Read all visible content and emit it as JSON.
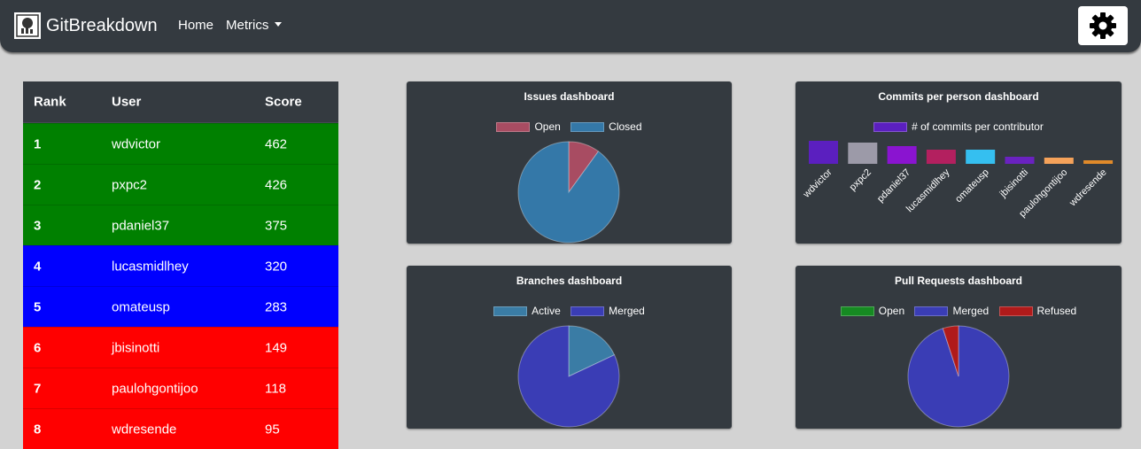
{
  "navbar": {
    "brand": "GitBreakdown",
    "home_label": "Home",
    "metrics_label": "Metrics",
    "logo_icon": "github-logo-icon",
    "settings_icon": "gear-icon"
  },
  "ranking": {
    "headers": [
      "Rank",
      "User",
      "Score"
    ],
    "rows": [
      {
        "rank": "1",
        "user": "wdvictor",
        "score": "462",
        "color": "#008000"
      },
      {
        "rank": "2",
        "user": "pxpc2",
        "score": "426",
        "color": "#008000"
      },
      {
        "rank": "3",
        "user": "pdaniel37",
        "score": "375",
        "color": "#008000"
      },
      {
        "rank": "4",
        "user": "lucasmidlhey",
        "score": "320",
        "color": "#0000ff"
      },
      {
        "rank": "5",
        "user": "omateusp",
        "score": "283",
        "color": "#0000ff"
      },
      {
        "rank": "6",
        "user": "jbisinotti",
        "score": "149",
        "color": "#ff0000"
      },
      {
        "rank": "7",
        "user": "paulohgontijoo",
        "score": "118",
        "color": "#ff0000"
      },
      {
        "rank": "8",
        "user": "wdresende",
        "score": "95",
        "color": "#ff0000"
      }
    ]
  },
  "issues": {
    "title": "Issues dashboard",
    "legend": [
      "Open",
      "Closed"
    ]
  },
  "commits": {
    "title": "Commits per person dashboard",
    "legend": "# of commits per contributor"
  },
  "branches": {
    "title": "Branches dashboard",
    "legend": [
      "Active",
      "Merged"
    ]
  },
  "pulls": {
    "title": "Pull Requests dashboard",
    "legend": [
      "Open",
      "Merged",
      "Refused"
    ]
  },
  "chart_data": [
    {
      "type": "pie",
      "title": "Issues dashboard",
      "labels": [
        "Open",
        "Closed"
      ],
      "values": [
        10,
        90
      ],
      "colors": [
        "#a84c62",
        "#3478a8"
      ]
    },
    {
      "type": "bar",
      "title": "Commits per person dashboard",
      "series": [
        {
          "name": "# of commits per contributor",
          "values": [
            26,
            24,
            20,
            16,
            16,
            8,
            7,
            4
          ]
        }
      ],
      "categories": [
        "wdvictor",
        "pxpc2",
        "pdaniel37",
        "lucasmidlhey",
        "omateusp",
        "jbisinotti",
        "paulohgontijoo",
        "wdresende"
      ],
      "colors": [
        "#5b1fbf",
        "#9c9aa8",
        "#8a14d0",
        "#b3205f",
        "#35bff0",
        "#6a22c0",
        "#f5a25a",
        "#e08a2a"
      ]
    },
    {
      "type": "pie",
      "title": "Branches dashboard",
      "labels": [
        "Active",
        "Merged"
      ],
      "values": [
        18,
        82
      ],
      "colors": [
        "#3a7ca5",
        "#3a3db5"
      ]
    },
    {
      "type": "pie",
      "title": "Pull Requests dashboard",
      "labels": [
        "Open",
        "Merged",
        "Refused"
      ],
      "values": [
        0,
        95,
        5
      ],
      "colors": [
        "#168a22",
        "#3a3db5",
        "#b01a1a"
      ]
    }
  ]
}
